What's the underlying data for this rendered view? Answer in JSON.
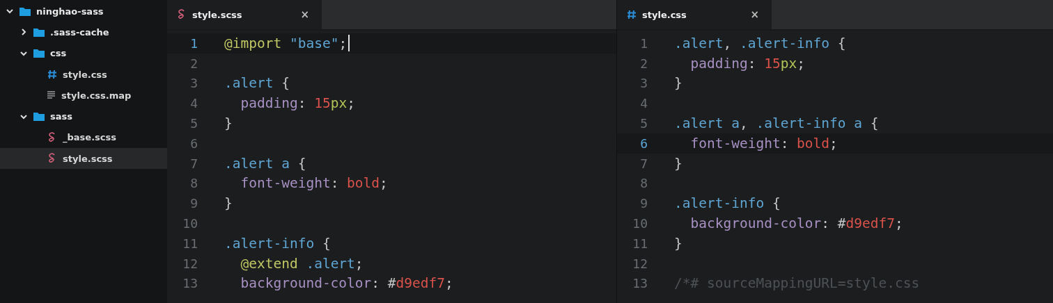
{
  "sidebar": {
    "tree": [
      {
        "name": "ninghao-sass",
        "kind": "folder",
        "expanded": true,
        "selected": false,
        "children": [
          {
            "name": ".sass-cache",
            "kind": "folder",
            "expanded": false,
            "selected": false
          },
          {
            "name": "css",
            "kind": "folder",
            "expanded": true,
            "selected": false,
            "children": [
              {
                "name": "style.css",
                "kind": "css",
                "selected": false
              },
              {
                "name": "style.css.map",
                "kind": "map",
                "selected": false
              }
            ]
          },
          {
            "name": "sass",
            "kind": "folder",
            "expanded": true,
            "selected": false,
            "children": [
              {
                "name": "_base.scss",
                "kind": "scss",
                "selected": false
              },
              {
                "name": "style.scss",
                "kind": "scss",
                "selected": true
              }
            ]
          }
        ]
      }
    ]
  },
  "panes": [
    {
      "tabs": [
        {
          "label": "style.scss",
          "kind": "scss",
          "selected": true,
          "close": "×"
        }
      ],
      "lines": [
        {
          "number": "1",
          "active": true,
          "cursor": true,
          "tokens": [
            {
              "kind": "keyword",
              "text": "@import"
            },
            {
              "kind": "string",
              "text": " \"base\""
            },
            {
              "kind": "punct",
              "text": ";"
            }
          ]
        },
        {
          "number": "2",
          "active": false,
          "cursor": false
        },
        {
          "number": "3",
          "active": false,
          "cursor": false,
          "tokens": [
            {
              "kind": "selector",
              "text": ".alert"
            },
            {
              "kind": "punct",
              "text": " {"
            }
          ]
        },
        {
          "number": "4",
          "active": false,
          "cursor": false,
          "tokens": [
            {
              "kind": "property",
              "text": "  padding"
            },
            {
              "kind": "punct",
              "text": ": "
            },
            {
              "kind": "number",
              "text": "15"
            },
            {
              "kind": "unit",
              "text": "px"
            },
            {
              "kind": "punct",
              "text": ";"
            }
          ]
        },
        {
          "number": "5",
          "active": false,
          "cursor": false,
          "tokens": [
            {
              "kind": "punct",
              "text": "}"
            }
          ]
        },
        {
          "number": "6",
          "active": false,
          "cursor": false
        },
        {
          "number": "7",
          "active": false,
          "cursor": false,
          "tokens": [
            {
              "kind": "selector",
              "text": ".alert a"
            },
            {
              "kind": "punct",
              "text": " {"
            }
          ]
        },
        {
          "number": "8",
          "active": false,
          "cursor": false,
          "tokens": [
            {
              "kind": "property",
              "text": "  font-weight"
            },
            {
              "kind": "punct",
              "text": ": "
            },
            {
              "kind": "value",
              "text": "bold"
            },
            {
              "kind": "punct",
              "text": ";"
            }
          ]
        },
        {
          "number": "9",
          "active": false,
          "cursor": false,
          "tokens": [
            {
              "kind": "punct",
              "text": "}"
            }
          ]
        },
        {
          "number": "10",
          "active": false,
          "cursor": false
        },
        {
          "number": "11",
          "active": false,
          "cursor": false,
          "tokens": [
            {
              "kind": "selector",
              "text": ".alert-info"
            },
            {
              "kind": "punct",
              "text": " {"
            }
          ]
        },
        {
          "number": "12",
          "active": false,
          "cursor": false,
          "tokens": [
            {
              "kind": "keyword",
              "text": "  @extend"
            },
            {
              "kind": "selector",
              "text": " .alert"
            },
            {
              "kind": "punct",
              "text": ";"
            }
          ]
        },
        {
          "number": "13",
          "active": false,
          "cursor": false,
          "tokens": [
            {
              "kind": "property",
              "text": "  background-color"
            },
            {
              "kind": "punct",
              "text": ": #"
            },
            {
              "kind": "value",
              "text": "d9edf7"
            },
            {
              "kind": "punct",
              "text": ";"
            }
          ]
        }
      ]
    },
    {
      "tabs": [
        {
          "label": "style.css",
          "kind": "css",
          "selected": true,
          "close": "×"
        }
      ],
      "lines": [
        {
          "number": "1",
          "active": false,
          "cursor": false,
          "tokens": [
            {
              "kind": "selector",
              "text": ".alert"
            },
            {
              "kind": "punct",
              "text": ", "
            },
            {
              "kind": "selector",
              "text": ".alert-info"
            },
            {
              "kind": "punct",
              "text": " {"
            }
          ]
        },
        {
          "number": "2",
          "active": false,
          "cursor": false,
          "tokens": [
            {
              "kind": "property",
              "text": "  padding"
            },
            {
              "kind": "punct",
              "text": ": "
            },
            {
              "kind": "number",
              "text": "15"
            },
            {
              "kind": "unit",
              "text": "px"
            },
            {
              "kind": "punct",
              "text": ";"
            }
          ]
        },
        {
          "number": "3",
          "active": false,
          "cursor": false,
          "tokens": [
            {
              "kind": "punct",
              "text": "}"
            }
          ]
        },
        {
          "number": "4",
          "active": false,
          "cursor": false
        },
        {
          "number": "5",
          "active": false,
          "cursor": false,
          "tokens": [
            {
              "kind": "selector",
              "text": ".alert a"
            },
            {
              "kind": "punct",
              "text": ", "
            },
            {
              "kind": "selector",
              "text": ".alert-info a"
            },
            {
              "kind": "punct",
              "text": " {"
            }
          ]
        },
        {
          "number": "6",
          "active": true,
          "cursor": false,
          "tokens": [
            {
              "kind": "property",
              "text": "  font-weight"
            },
            {
              "kind": "punct",
              "text": ": "
            },
            {
              "kind": "value",
              "text": "bold"
            },
            {
              "kind": "punct",
              "text": ";"
            }
          ]
        },
        {
          "number": "7",
          "active": false,
          "cursor": false,
          "tokens": [
            {
              "kind": "punct",
              "text": "}"
            }
          ]
        },
        {
          "number": "8",
          "active": false,
          "cursor": false
        },
        {
          "number": "9",
          "active": false,
          "cursor": false,
          "tokens": [
            {
              "kind": "selector",
              "text": ".alert-info"
            },
            {
              "kind": "punct",
              "text": " {"
            }
          ]
        },
        {
          "number": "10",
          "active": false,
          "cursor": false,
          "tokens": [
            {
              "kind": "property",
              "text": "  background-color"
            },
            {
              "kind": "punct",
              "text": ": #"
            },
            {
              "kind": "value",
              "text": "d9edf7"
            },
            {
              "kind": "punct",
              "text": ";"
            }
          ]
        },
        {
          "number": "11",
          "active": false,
          "cursor": false,
          "tokens": [
            {
              "kind": "punct",
              "text": "}"
            }
          ]
        },
        {
          "number": "12",
          "active": false,
          "cursor": false
        },
        {
          "number": "13",
          "active": false,
          "cursor": false,
          "tokens": [
            {
              "kind": "comment",
              "text": "/*# sourceMappingURL=style.css"
            }
          ]
        }
      ]
    }
  ]
}
